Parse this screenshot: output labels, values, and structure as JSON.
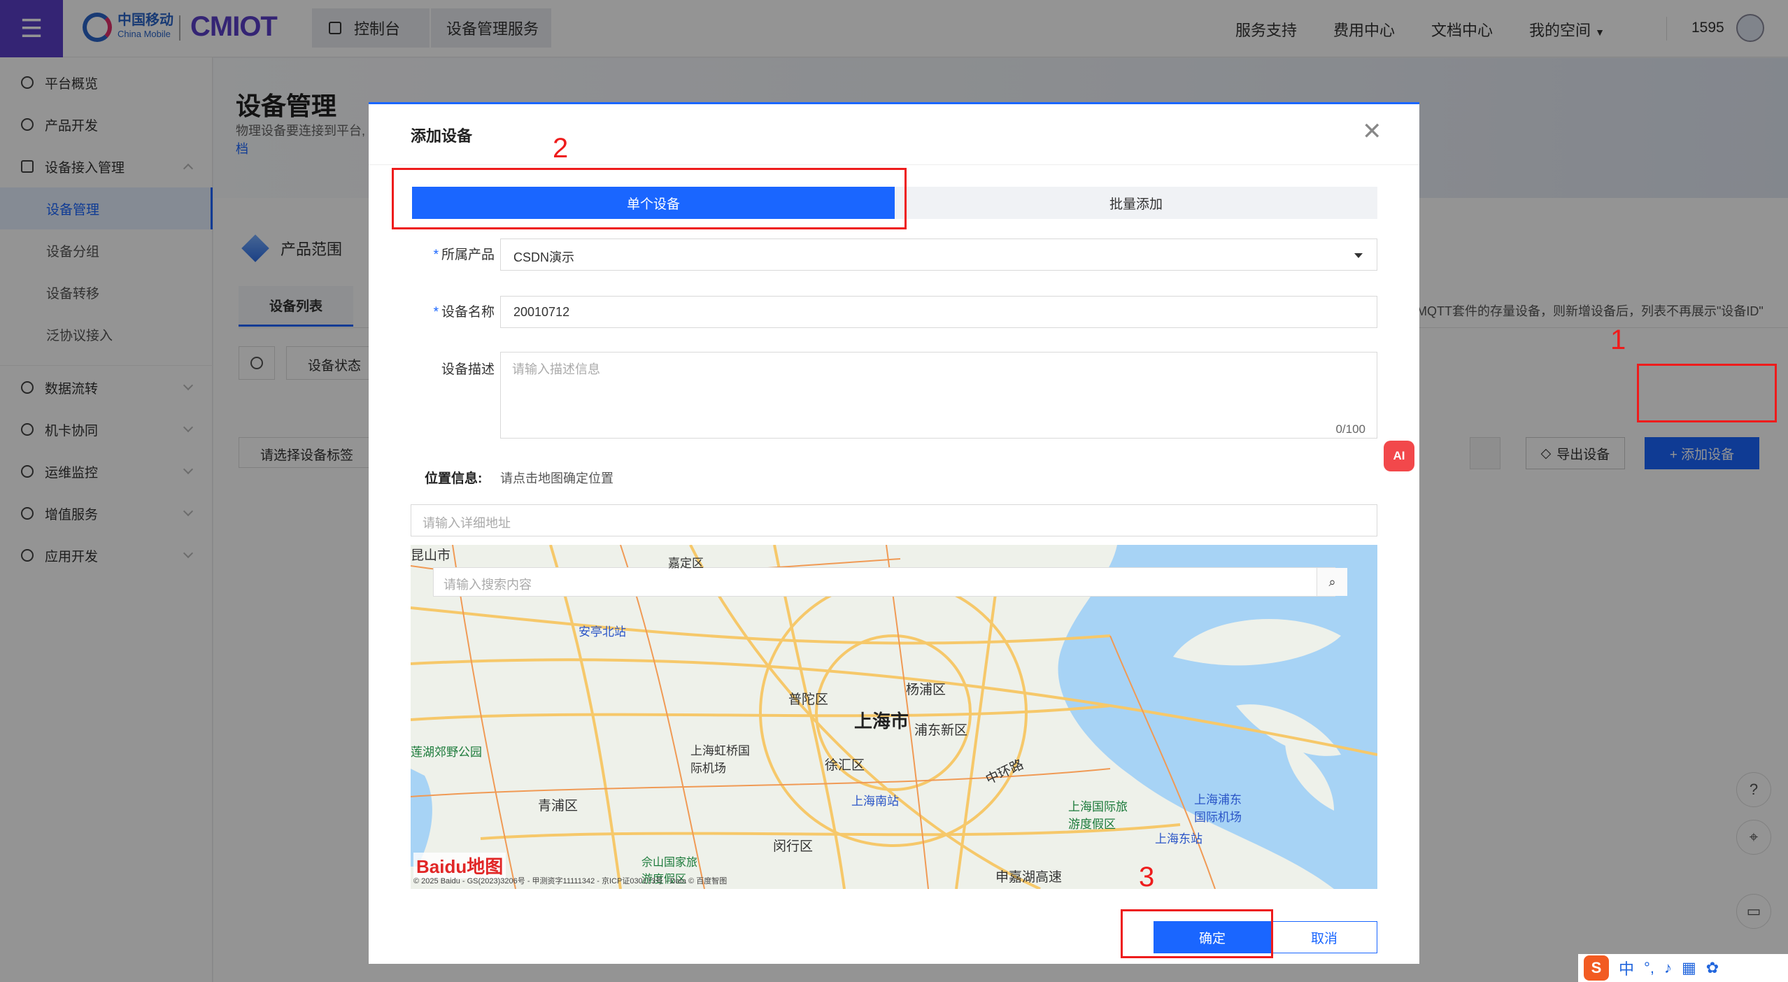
{
  "topbar": {
    "brand_cn": "中国移动",
    "brand_en": "China Mobile",
    "product_logo": "CMIOT",
    "breadcrumb": [
      "控制台",
      "设备管理服务"
    ],
    "nav": [
      "服务支持",
      "费用中心",
      "文档中心",
      "我的空间"
    ],
    "user_id": "1595"
  },
  "sidebar": {
    "items": [
      {
        "label": "平台概览",
        "icon": "dashboard-icon"
      },
      {
        "label": "产品开发",
        "icon": "cube-icon"
      },
      {
        "label": "设备接入管理",
        "icon": "device-icon"
      },
      {
        "label": "数据流转",
        "icon": "flow-icon"
      },
      {
        "label": "机卡协同",
        "icon": "link-icon"
      },
      {
        "label": "运维监控",
        "icon": "monitor-icon"
      },
      {
        "label": "增值服务",
        "icon": "send-icon"
      },
      {
        "label": "应用开发",
        "icon": "code-icon"
      }
    ],
    "sub_items": [
      "设备管理",
      "设备分组",
      "设备转移",
      "泛协议接入"
    ],
    "active_sub": "设备管理"
  },
  "page": {
    "title": "设备管理",
    "desc": "物理设备要连接到平台,",
    "desc_link": "档",
    "product_range": "产品范围",
    "tab": "设备列表",
    "hint": "MQTT套件的存量设备，则新增设备后，列表不再展示\"设备ID\"",
    "filter_status": "设备状态（",
    "tag_select": "请选择设备标签",
    "export_label": "导出设备",
    "add_label": "+ 添加设备"
  },
  "modal": {
    "title": "添加设备",
    "tabs": [
      "单个设备",
      "批量添加"
    ],
    "product_label": "所属产品",
    "product_value": "CSDN演示",
    "name_label": "设备名称",
    "name_value": "20010712",
    "desc_label": "设备描述",
    "desc_placeholder": "请输入描述信息",
    "desc_counter": "0/100",
    "location_label": "位置信息:",
    "location_hint": "请点击地图确定位置",
    "address_placeholder": "请输入详细地址",
    "map_search_placeholder": "请输入搜索内容",
    "ok_label": "确定",
    "cancel_label": "取消"
  },
  "map": {
    "labels": {
      "city": "上海市",
      "kunshan": "昆山市",
      "jiading": "嘉定区",
      "anting": "安亭北站",
      "putuo": "普陀区",
      "yangpu": "杨浦区",
      "pudong": "浦东新区",
      "hongqiao": "上海虹桥国际机场",
      "xuhui": "徐汇区",
      "zhonghuan": "中环路",
      "qingpu": "青浦区",
      "south_station": "上海南站",
      "dianshan": "莲湖郊野公园",
      "minhang": "闵行区",
      "sheshan": "佘山国家旅游度假区",
      "resort": "上海国际旅游度假区",
      "pudong_airport": "上海浦东国际机场",
      "east_station": "上海东站",
      "shenjia": "申嘉湖高速"
    },
    "baidu_logo": "Baidu地图",
    "copyright": "© 2025 Baidu - GS(2023)3206号 - 甲测资字11111342 - 京ICP证030173号 - Data © 百度智图"
  },
  "annotations": [
    "1",
    "2",
    "3"
  ],
  "ime": {
    "mode": "中"
  },
  "colors": {
    "primary": "#1a66ff",
    "brand_purple": "#5b3ec8",
    "annotation_red": "#ee1c1c"
  }
}
